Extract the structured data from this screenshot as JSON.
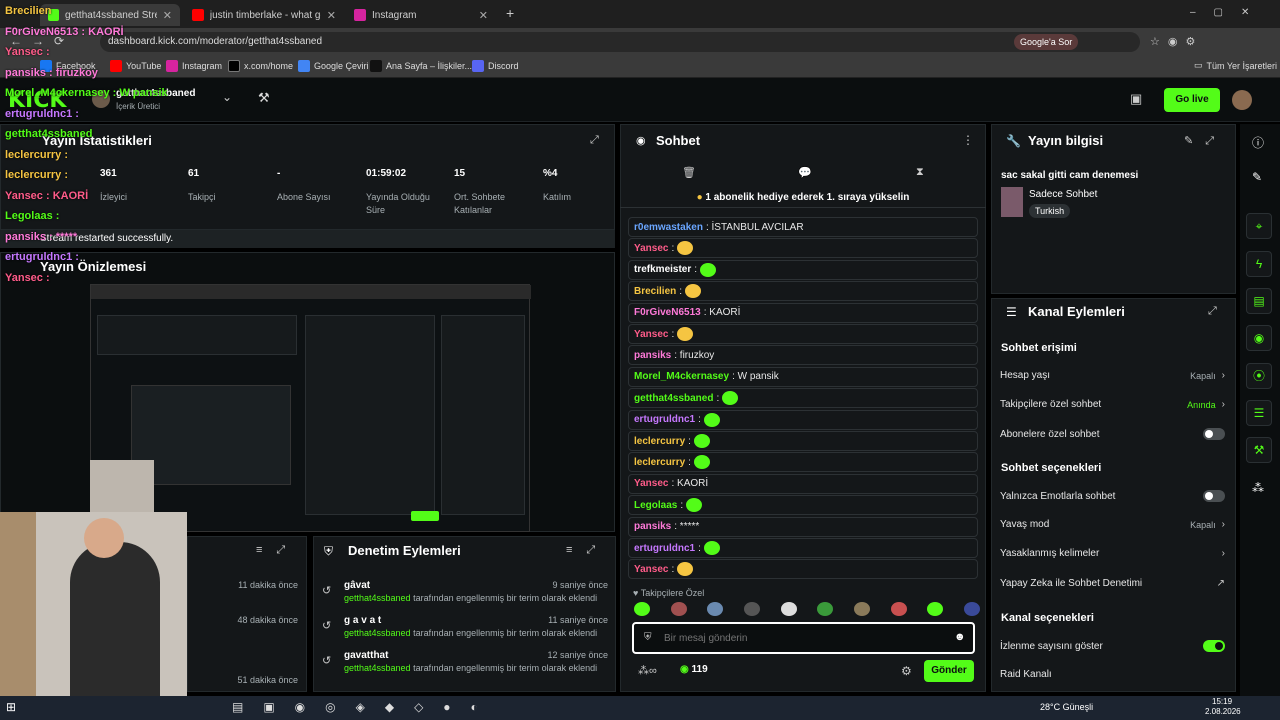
{
  "browser": {
    "tabs": [
      {
        "label": "getthat4ssbaned Stream - Kick"
      },
      {
        "label": "justin timberlake - what goes a"
      },
      {
        "label": "Instagram"
      }
    ],
    "url": "dashboard.kick.com/moderator/getthat4ssbaned",
    "google_say": "Google'a Sor",
    "bookmarks": [
      "Facebook",
      "YouTube",
      "Instagram",
      "x.com/home",
      "Google Çeviri",
      "Ana Sayfa – İlişkiler...",
      "Discord"
    ],
    "all_bookmarks": "Tüm Yer İşaretleri"
  },
  "top": {
    "logo": "KICK",
    "channel": "getthat4ssbaned",
    "role": "İçerik Üretici",
    "go_live": "Go live"
  },
  "stats": {
    "title": "Yayın İstatistikleri",
    "items": [
      {
        "value": "361",
        "label": "İzleyici"
      },
      {
        "value": "61",
        "label": "Takipçi"
      },
      {
        "value": "-",
        "label": "Abone Sayısı"
      },
      {
        "value": "01:59:02",
        "label": "Yayında Olduğu Süre"
      },
      {
        "value": "15",
        "label": "Ort. Sohbete Katılanlar"
      },
      {
        "value": "%4",
        "label": "Katılım"
      }
    ]
  },
  "preview": {
    "title": "Yayın Önizlemesi",
    "toast": "Stream restarted successfully."
  },
  "activity": {
    "times": [
      "11 dakika önce",
      "48 dakika önce",
      "51 dakika önce"
    ]
  },
  "mod_actions": {
    "title": "Denetim Eylemleri",
    "items": [
      {
        "term": "gâvat",
        "by": "getthat4ssbaned",
        "text": "tarafından engellenmiş bir terim olarak eklendi",
        "time": "9 saniye önce"
      },
      {
        "term": "g a v a t",
        "by": "getthat4ssbaned",
        "text": "tarafından engellenmiş bir terim olarak eklendi",
        "time": "11 saniye önce"
      },
      {
        "term": "gavatthat",
        "by": "getthat4ssbaned",
        "text": "tarafından engellenmiş bir terim olarak eklendi",
        "time": "12 saniye önce"
      }
    ]
  },
  "chat": {
    "title": "Sohbet",
    "promo": "1 abonelik hediye ederek 1. sıraya yükselin",
    "messages": [
      {
        "user": "r0emwastaken",
        "text": ": İSTANBUL AVCILAR",
        "color": "#6aa6ff"
      },
      {
        "user": "Yansec",
        "text": ":",
        "color": "#ff5c8a",
        "emote": "y"
      },
      {
        "user": "trefkmeister",
        "text": ":",
        "color": "#ffffff",
        "emote": "g"
      },
      {
        "user": "Brecilien",
        "text": ":",
        "color": "#f5c542",
        "emote": "y"
      },
      {
        "user": "F0rGiveN6513",
        "text": ": KAORİ",
        "color": "#ff7ad9"
      },
      {
        "user": "Yansec",
        "text": ":",
        "color": "#ff5c8a",
        "emote": "y"
      },
      {
        "user": "pansiks",
        "text": ": firuzkoy",
        "color": "#ff7ad9"
      },
      {
        "user": "Morel_M4ckernasey",
        "text": ": W pansik",
        "color": "#53fc18"
      },
      {
        "user": "getthat4ssbaned",
        "text": ":",
        "color": "#53fc18",
        "emote": "g"
      },
      {
        "user": "ertugruldnc1",
        "text": ":",
        "color": "#c678ff",
        "emote": "g"
      },
      {
        "user": "leclercurry",
        "text": ":",
        "color": "#f5c542",
        "emote": "g"
      },
      {
        "user": "leclercurry",
        "text": ":",
        "color": "#f5c542",
        "emote": "g"
      },
      {
        "user": "Yansec",
        "text": ": KAORİ",
        "color": "#ff5c8a"
      },
      {
        "user": "Legolaas",
        "text": ":",
        "color": "#53fc18",
        "emote": "g"
      },
      {
        "user": "pansiks",
        "text": ": *****",
        "color": "#ff7ad9"
      },
      {
        "user": "ertugruldnc1",
        "text": ":",
        "color": "#c678ff",
        "emote": "g"
      },
      {
        "user": "Yansec",
        "text": ":",
        "color": "#ff5c8a",
        "emote": "y"
      }
    ],
    "follower_only": "Takipçilere Özel",
    "placeholder": "Bir mesaj gönderin",
    "count": "119",
    "send": "Gönder"
  },
  "stream_info": {
    "title": "Yayın bilgisi",
    "stream_title": "sac sakal gitti cam denemesi",
    "category": "Sadece Sohbet",
    "tag": "Turkish"
  },
  "channel_actions": {
    "title": "Kanal Eylemleri",
    "access": "Sohbet erişimi",
    "rows1": [
      {
        "label": "Hesap yaşı",
        "value": "Kapalı"
      },
      {
        "label": "Takipçilere özel sohbet",
        "value": "Anında"
      },
      {
        "label": "Abonelere özel sohbet",
        "toggle": false
      }
    ],
    "options": "Sohbet seçenekleri",
    "rows2": [
      {
        "label": "Yalnızca Emotlarla sohbet",
        "toggle": false
      },
      {
        "label": "Yavaş mod",
        "value": "Kapalı"
      },
      {
        "label": "Yasaklanmış kelimeler"
      },
      {
        "label": "Yapay Zeka ile Sohbet Denetimi"
      }
    ],
    "chan_options": "Kanal seçenekleri",
    "rows3": [
      {
        "label": "İzlenme sayısını göster",
        "toggle": true
      },
      {
        "label": "Raid Kanalı"
      }
    ]
  },
  "overlay": [
    {
      "user": "Brecilien",
      "color": "#f5c542"
    },
    {
      "user": "F0rGiveN6513 : KAORİ",
      "color": "#ff7ad9"
    },
    {
      "user": "Yansec :",
      "color": "#ff5c8a"
    },
    {
      "user": "pansiks : firuzkoy",
      "color": "#ff7ad9"
    },
    {
      "user": "Morel_M4ckernasey : W pansik",
      "color": "#53fc18"
    },
    {
      "user": "ertugruldnc1 :",
      "color": "#c678ff"
    },
    {
      "user": "getthat4ssbaned",
      "color": "#53fc18"
    },
    {
      "user": "leclercurry :",
      "color": "#f5c542"
    },
    {
      "user": "leclercurry :",
      "color": "#f5c542"
    },
    {
      "user": "Yansec : KAORİ",
      "color": "#ff5c8a"
    },
    {
      "user": "Legolaas :",
      "color": "#53fc18"
    },
    {
      "user": "pansiks : *****",
      "color": "#ff7ad9"
    },
    {
      "user": "ertugruldnc1 :",
      "color": "#c678ff"
    },
    {
      "user": "Yansec :",
      "color": "#ff5c8a"
    }
  ],
  "taskbar": {
    "weather": "28°C Güneşli",
    "time": "15:19",
    "date": "2.08.2026"
  }
}
